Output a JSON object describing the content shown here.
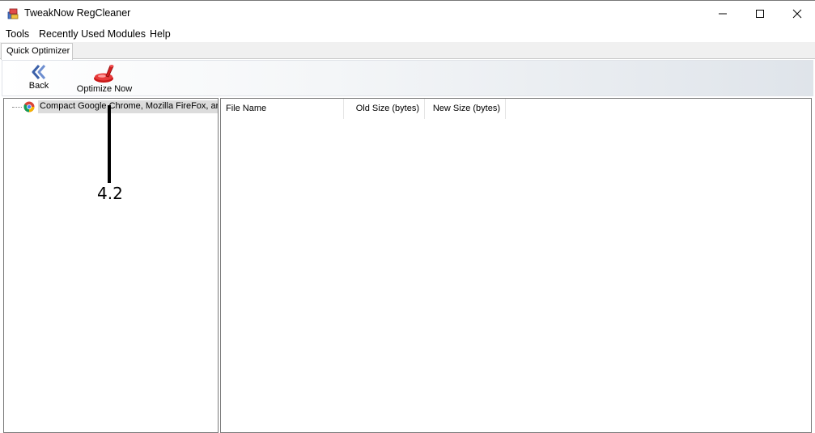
{
  "window": {
    "title": "TweakNow RegCleaner",
    "icon": "regcleaner-app-icon",
    "controls": [
      "minimize-icon",
      "maximize-icon",
      "close-icon"
    ]
  },
  "menu": {
    "items": [
      "Tools",
      "Recently Used Modules",
      "Help"
    ]
  },
  "tabs": [
    {
      "label": "Quick Optimizer",
      "active": true
    }
  ],
  "toolbar": {
    "back_label": "Back",
    "back_icon": "double-chevron-left-icon",
    "optimize_label": "Optimize Now",
    "optimize_icon": "optimize-cleaner-icon"
  },
  "tree": {
    "items": [
      {
        "label": "Compact Google Chrome, Mozilla FireFox, and",
        "icon": "chrome-icon",
        "selected": true
      }
    ]
  },
  "list": {
    "columns": [
      "File Name",
      "Old Size (bytes)",
      "New Size (bytes)"
    ],
    "rows": []
  },
  "annotation": {
    "label": "4.2"
  },
  "colors": {
    "accent_red": "#d42020",
    "back_blue": "#3a5fa8",
    "selection_gray": "#dcdcdc"
  }
}
